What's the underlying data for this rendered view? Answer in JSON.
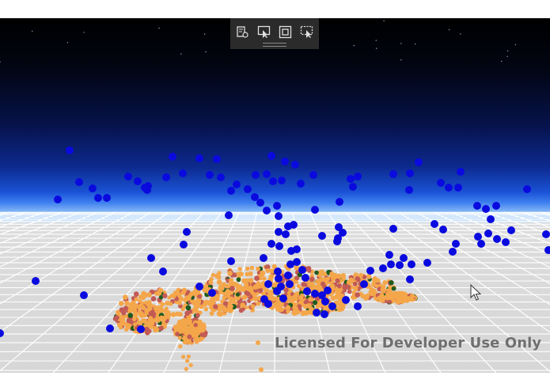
{
  "toolbar": {
    "buttons": [
      {
        "name": "select-properties-icon"
      },
      {
        "name": "select-pointer-icon"
      },
      {
        "name": "select-box-icon"
      },
      {
        "name": "select-multiple-icon"
      }
    ]
  },
  "watermark": {
    "text": "Licensed For Developer Use Only"
  },
  "scene": {
    "sky_color": "#0d2a8f",
    "floor_color": "#d9d9d9",
    "blue_point_color": "#0a0adf",
    "orange_point_color": "#f4a64a",
    "red_point_color": "#c25a55",
    "green_point_color": "#1f5a1f"
  }
}
